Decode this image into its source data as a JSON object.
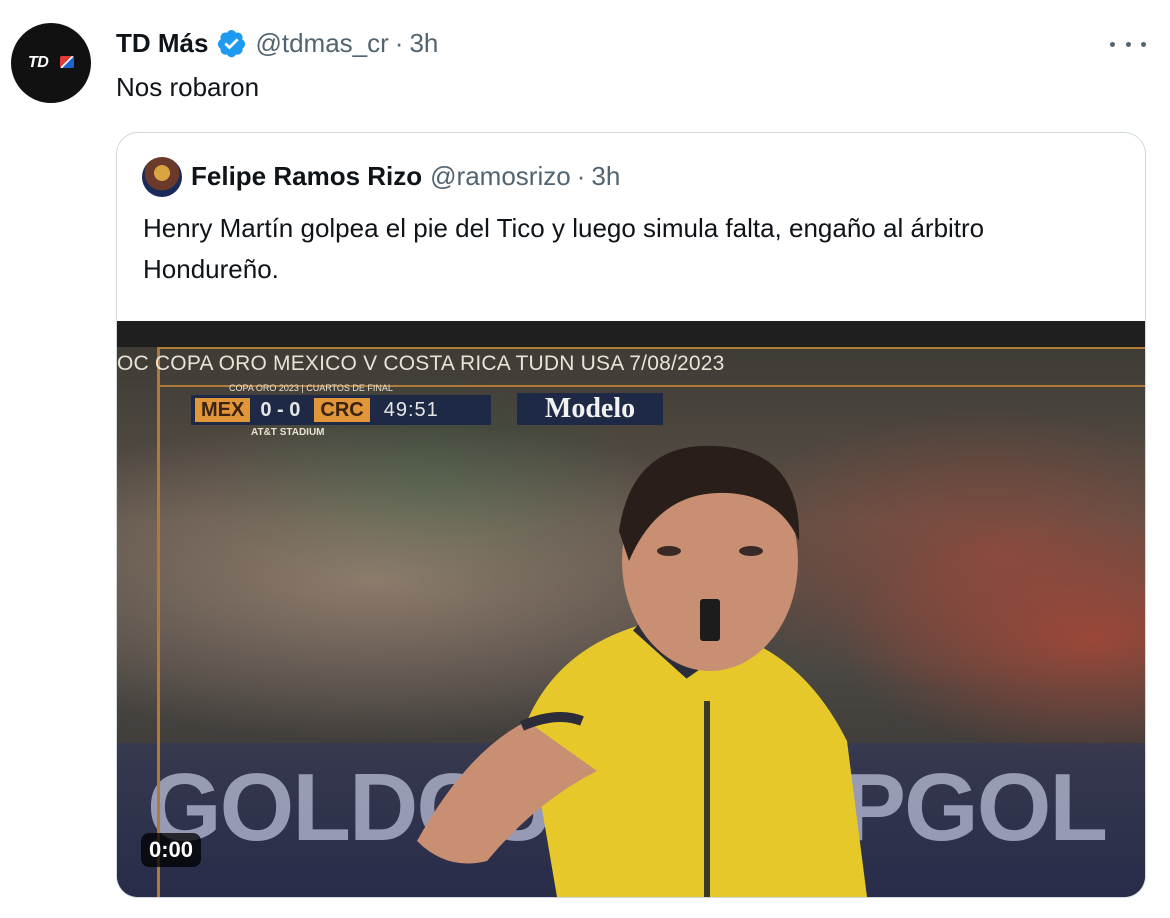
{
  "tweet": {
    "avatar_text": "TD",
    "display_name": "TD Más",
    "handle": "@tdmas_cr",
    "separator": "·",
    "time": "3h",
    "text": "Nos robaron"
  },
  "quoted": {
    "display_name": "Felipe Ramos Rizo",
    "handle": "@ramosrizo",
    "separator": "·",
    "time": "3h",
    "text": "Henry Martín golpea el pie del Tico y luego simula falta, engaño al árbitro Hondureño.",
    "video": {
      "caption": "OC COPA ORO MEXICO V COSTA RICA TUDN USA 7/08/2023",
      "scorebug": {
        "subtitle": "COPA ORO 2023 | CUARTOS DE FINAL",
        "home": "MEX",
        "home_score": "0",
        "score_sep": "-",
        "away_score": "0",
        "away": "CRC",
        "clock": "49:51",
        "venue": "AT&T STADIUM"
      },
      "sponsor": "Modelo",
      "board_left": "GOLDCUP",
      "board_right": "PGOL",
      "timestamp": "0:00"
    }
  },
  "colors": {
    "verified": "#1d9bf0",
    "secondary_text": "#536471",
    "border": "#cfd9de"
  },
  "icons": {
    "verified": "verified-badge-icon",
    "more": "more-options-icon"
  }
}
